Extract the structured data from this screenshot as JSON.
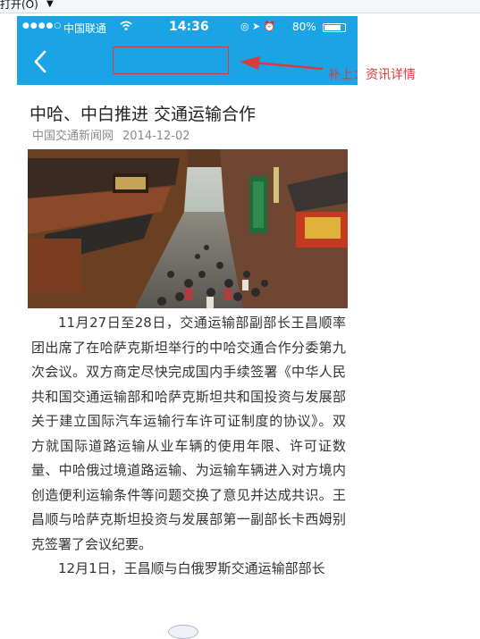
{
  "host_toolbar": {
    "open_label": "打开(O)",
    "dropdown_glyph": "▼"
  },
  "status_bar": {
    "signal_dots": "●●●●○",
    "carrier": "中国联通",
    "wifi_icon": "wifi-icon",
    "time": "14:36",
    "right_icons": "◎ ➤ ⏰",
    "battery_percent": "80%",
    "battery_level": 0.8
  },
  "nav_bar": {
    "back_icon": "chevron-left-icon",
    "title_placeholder": ""
  },
  "annotation": {
    "label": "补上：资讯详情",
    "color": "#d83b3b"
  },
  "article": {
    "title": "中哈、中白推进 交通运输合作",
    "source": "中国交通新闻网",
    "date": "2014-12-02",
    "paragraphs": [
      "11月27日至28日，交通运输部副部长王昌顺率团出席了在哈萨克斯坦举行的中哈交通合作分委第九次会议。双方商定尽快完成国内手续签署《中华人民共和国交通运输部和哈萨克斯坦共和国投资与发展部关于建立国际汽车运输行车许可证制度的协议》。双方就国际道路运输从业车辆的使用年限、许可证数量、中哈俄过境道路运输、为运输车辆进入对方境内创造便利运输条件等问题交换了意见并达成共识。王昌顺与哈萨克斯坦投资与发展部第一副部长卡西姆别克签署了会议纪要。",
      "12月1日，王昌顺与白俄罗斯交通运输部部长"
    ]
  },
  "colors": {
    "nav_blue": "#1aa4e6",
    "annotation_red": "#d83b3b"
  }
}
